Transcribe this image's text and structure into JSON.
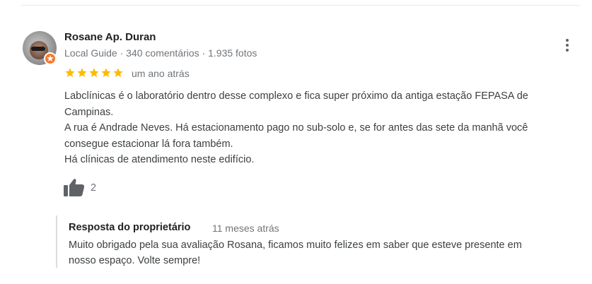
{
  "review": {
    "author_name": "Rosane Ap. Duran",
    "author_meta": "Local Guide · 340 comentários · 1.935 fotos",
    "rating": 5,
    "rating_max": 5,
    "star_color": "#fbbc04",
    "time_ago": "um ano atrás",
    "text_lines": [
      "Labclínicas é o laboratório dentro desse complexo e fica super próximo da antiga estação FEPASA de",
      "Campinas.",
      "A rua é Andrade Neves. Há estacionamento pago no sub-solo e, se for antes das sete da manhã você",
      "consegue estacionar lá fora também.",
      "Há clínicas de atendimento neste edifício."
    ],
    "like_count": "2",
    "icons": {
      "more": "more-vert-icon",
      "like": "thumbs-up-icon",
      "badge": "local-guide-badge-icon"
    }
  },
  "owner_response": {
    "heading": "Resposta do proprietário",
    "time_ago": "11 meses atrás",
    "text_lines": [
      "Muito obrigado pela sua avaliação Rosana, ficamos muito felizes em saber que esteve presente em",
      "nosso espaço. Volte sempre!"
    ]
  },
  "colors": {
    "badge": "#f4792b",
    "meta_text": "#70757a",
    "body_text": "#3c4043"
  }
}
